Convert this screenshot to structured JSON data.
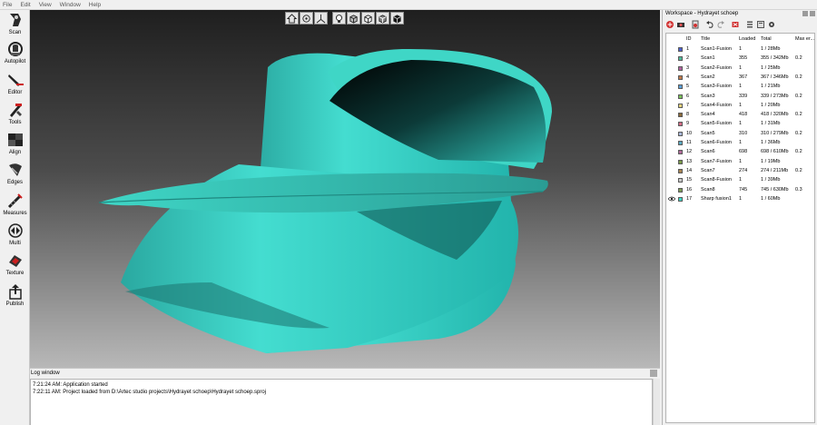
{
  "menu": [
    "File",
    "Edit",
    "View",
    "Window",
    "Help"
  ],
  "toolbar": {
    "tools": [
      {
        "label": "Scan",
        "icon": "scan-icon"
      },
      {
        "label": "Autopilot",
        "icon": "autopilot-icon"
      },
      {
        "label": "Editor",
        "icon": "editor-icon"
      },
      {
        "label": "Tools",
        "icon": "tools-icon"
      },
      {
        "label": "Align",
        "icon": "align-icon"
      },
      {
        "label": "Edges",
        "icon": "edges-icon"
      },
      {
        "label": "Measures",
        "icon": "measures-icon"
      },
      {
        "label": "Multi",
        "icon": "multi-icon"
      },
      {
        "label": "Texture",
        "icon": "texture-icon"
      },
      {
        "label": "Publish",
        "icon": "publish-icon"
      }
    ]
  },
  "view_toolbar": {
    "buttons": [
      "home-view-icon",
      "rotate-view-icon",
      "axes-icon",
      "light-bulb-icon",
      "solid-cube-icon",
      "wire-cube-icon",
      "textured-cube-icon",
      "black-cube-icon"
    ]
  },
  "log": {
    "title": "Log window",
    "lines": [
      "7:21:24 AM: Application started",
      "7:22:11 AM: Project loaded from D:\\Artec studio projects\\Hydrayet schoep\\Hydrayet schoep.sproj"
    ]
  },
  "workspace": {
    "title": "Workspace - Hydrayet schoep",
    "columns": {
      "id": "ID",
      "title": "Title",
      "loaded": "Loaded",
      "total": "Total",
      "max_error": "Max er..."
    },
    "rows": [
      {
        "id": "1",
        "title": "Scan1-Fusion",
        "loaded": "1",
        "total": "1 / 28Mb",
        "max_error": "",
        "color": "#4a5fd0",
        "visible": false
      },
      {
        "id": "2",
        "title": "Scan1",
        "loaded": "355",
        "total": "355 / 342Mb",
        "max_error": "0.2",
        "color": "#4fb89a",
        "visible": false
      },
      {
        "id": "3",
        "title": "Scan2-Fusion",
        "loaded": "1",
        "total": "1 / 25Mb",
        "max_error": "",
        "color": "#b0629e",
        "visible": false
      },
      {
        "id": "4",
        "title": "Scan2",
        "loaded": "367",
        "total": "367 / 346Mb",
        "max_error": "0.2",
        "color": "#c07a4a",
        "visible": false
      },
      {
        "id": "5",
        "title": "Scan3-Fusion",
        "loaded": "1",
        "total": "1 / 21Mb",
        "max_error": "",
        "color": "#5b9fd6",
        "visible": false
      },
      {
        "id": "6",
        "title": "Scan3",
        "loaded": "339",
        "total": "339 / 273Mb",
        "max_error": "0.2",
        "color": "#7ac25a",
        "visible": false
      },
      {
        "id": "7",
        "title": "Scan4-Fusion",
        "loaded": "1",
        "total": "1 / 20Mb",
        "max_error": "",
        "color": "#e3d37c",
        "visible": false
      },
      {
        "id": "8",
        "title": "Scan4",
        "loaded": "418",
        "total": "418 / 320Mb",
        "max_error": "0.2",
        "color": "#8a6a3a",
        "visible": false
      },
      {
        "id": "9",
        "title": "Scan5-Fusion",
        "loaded": "1",
        "total": "1 / 31Mb",
        "max_error": "",
        "color": "#d26c86",
        "visible": false
      },
      {
        "id": "10",
        "title": "Scan5",
        "loaded": "310",
        "total": "310 / 279Mb",
        "max_error": "0.2",
        "color": "#a9b7d8",
        "visible": false
      },
      {
        "id": "11",
        "title": "Scan6-Fusion",
        "loaded": "1",
        "total": "1 / 36Mb",
        "max_error": "",
        "color": "#5aa8c0",
        "visible": false
      },
      {
        "id": "12",
        "title": "Scan6",
        "loaded": "698",
        "total": "698 / 610Mb",
        "max_error": "0.2",
        "color": "#b06a9a",
        "visible": false
      },
      {
        "id": "13",
        "title": "Scan7-Fusion",
        "loaded": "1",
        "total": "1 / 19Mb",
        "max_error": "",
        "color": "#7a9a4a",
        "visible": false
      },
      {
        "id": "14",
        "title": "Scan7",
        "loaded": "274",
        "total": "274 / 211Mb",
        "max_error": "0.2",
        "color": "#a88452",
        "visible": false
      },
      {
        "id": "15",
        "title": "Scan8-Fusion",
        "loaded": "1",
        "total": "1 / 39Mb",
        "max_error": "",
        "color": "#c9c9c9",
        "visible": false
      },
      {
        "id": "16",
        "title": "Scan8",
        "loaded": "745",
        "total": "745 / 630Mb",
        "max_error": "0.3",
        "color": "#7e9e58",
        "visible": false
      },
      {
        "id": "17",
        "title": "Sharp fusion1",
        "loaded": "1",
        "total": "1 / 60Mb",
        "max_error": "",
        "color": "#3fd6c6",
        "visible": true
      }
    ]
  },
  "model": {
    "color": "#3fd6c6"
  }
}
